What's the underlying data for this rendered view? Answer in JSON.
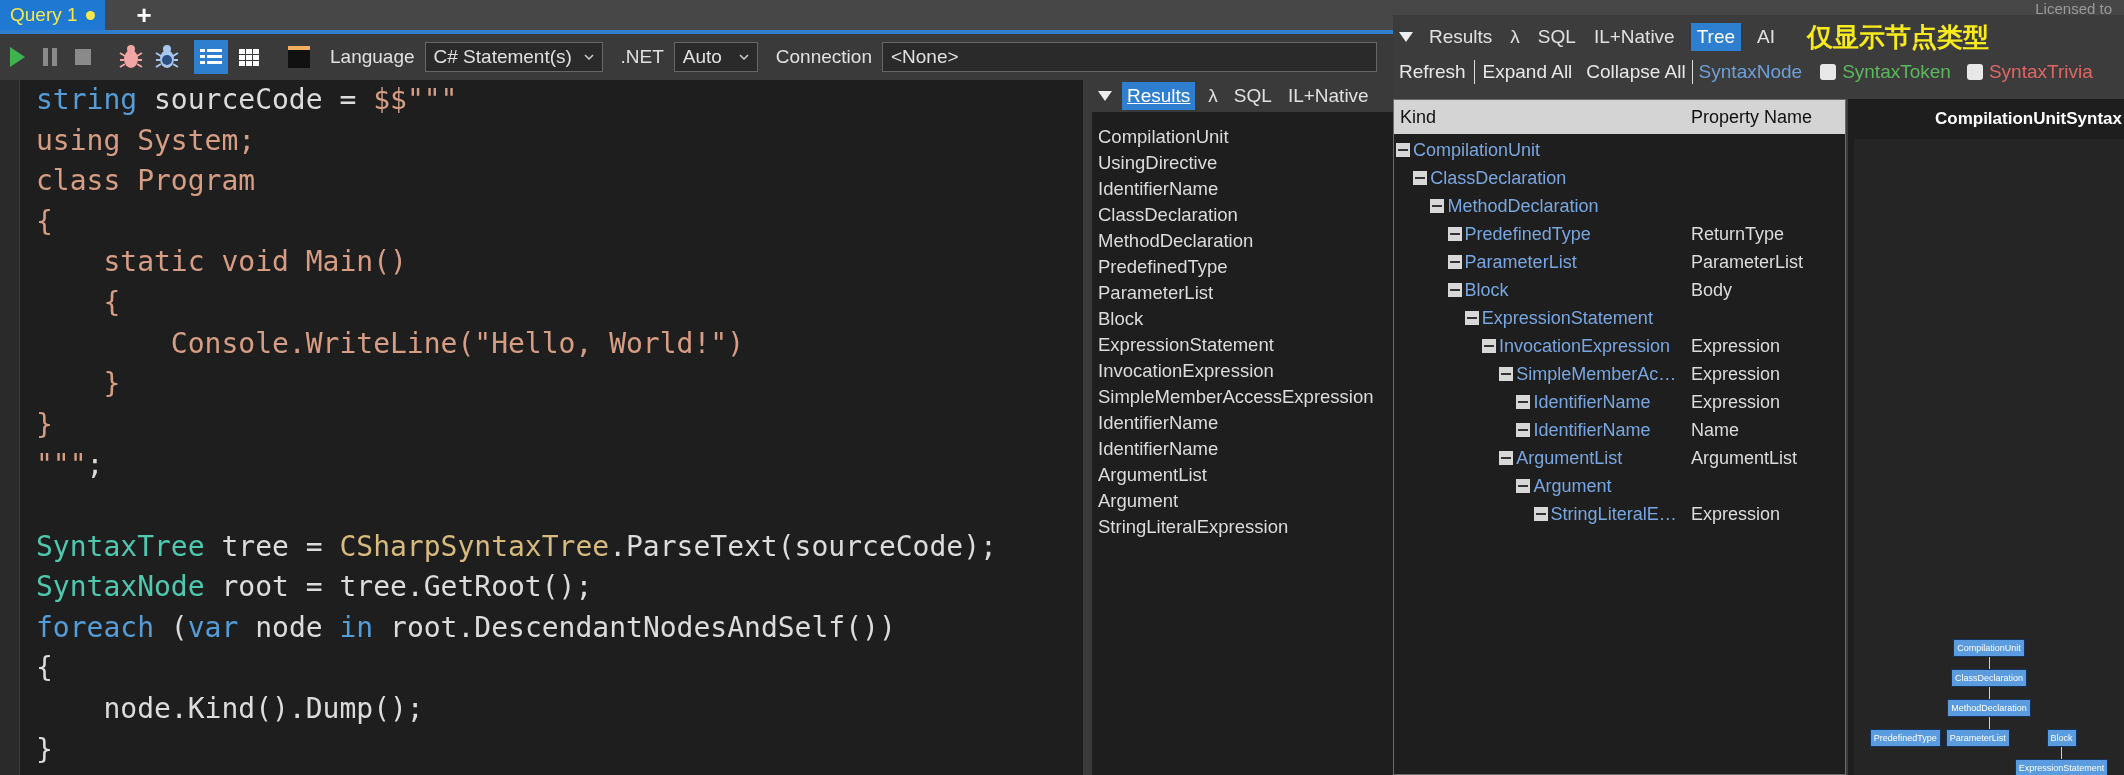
{
  "query_tabs": [
    {
      "label": "Query 1",
      "selected": true,
      "unsaved": true
    }
  ],
  "new_tab": "+",
  "licensed_text": "Licensed to",
  "toolbar": {
    "view_modes": [
      {
        "kind": "rich",
        "selected": true
      },
      {
        "kind": "grid",
        "selected": false
      }
    ],
    "language": {
      "label": "Language",
      "value": "C# Statement(s)"
    },
    "dotnet": {
      "label": ".NET",
      "value": "Auto"
    },
    "connection": {
      "label": "Connection",
      "value": "<None>"
    }
  },
  "editor": {
    "lines": [
      [
        {
          "text": "string",
          "kind": "keyword"
        },
        {
          "text": " sourceCode = ",
          "kind": "plain"
        },
        {
          "text": "$$\"\"\"",
          "kind": "string"
        }
      ],
      [
        {
          "text": "using System;",
          "kind": "string"
        }
      ],
      [
        {
          "text": "class Program",
          "kind": "string"
        }
      ],
      [
        {
          "text": "{",
          "kind": "string"
        }
      ],
      [
        {
          "text": "    static void Main()",
          "kind": "string"
        }
      ],
      [
        {
          "text": "    {",
          "kind": "string"
        }
      ],
      [
        {
          "text": "        Console.WriteLine(\"Hello, World!\")",
          "kind": "string"
        }
      ],
      [
        {
          "text": "    }",
          "kind": "string"
        }
      ],
      [
        {
          "text": "}",
          "kind": "string"
        }
      ],
      [
        {
          "text": "\"\"\"",
          "kind": "string"
        },
        {
          "text": ";",
          "kind": "plain"
        }
      ],
      [
        {
          "text": "SyntaxTree",
          "kind": "type",
          "blank_line_before": true
        },
        {
          "text": " tree = ",
          "kind": "plain"
        },
        {
          "text": "CSharpSyntaxTree",
          "kind": "class"
        },
        {
          "text": ".ParseText(sourceCode);",
          "kind": "plain"
        }
      ],
      [
        {
          "text": "SyntaxNode",
          "kind": "type"
        },
        {
          "text": " root = tree.GetRoot();",
          "kind": "plain"
        }
      ],
      [
        {
          "text": "foreach",
          "kind": "keyword"
        },
        {
          "text": " (",
          "kind": "plain"
        },
        {
          "text": "var",
          "kind": "keyword"
        },
        {
          "text": " node ",
          "kind": "plain"
        },
        {
          "text": "in",
          "kind": "keyword"
        },
        {
          "text": " root.DescendantNodesAndSelf())",
          "kind": "plain"
        }
      ],
      [
        {
          "text": "{",
          "kind": "plain"
        }
      ],
      [
        {
          "text": "    node.Kind().Dump();",
          "kind": "plain"
        }
      ],
      [
        {
          "text": "}",
          "kind": "plain"
        }
      ]
    ]
  },
  "results_panel": {
    "tabs": [
      {
        "label": "Results",
        "selected": true
      },
      {
        "label": "λ",
        "selected": false
      },
      {
        "label": "SQL",
        "selected": false
      },
      {
        "label": "IL+Native",
        "selected": false
      }
    ],
    "items": [
      "CompilationUnit",
      "UsingDirective",
      "IdentifierName",
      "ClassDeclaration",
      "MethodDeclaration",
      "PredefinedType",
      "ParameterList",
      "Block",
      "ExpressionStatement",
      "InvocationExpression",
      "SimpleMemberAccessExpression",
      "IdentifierName",
      "IdentifierName",
      "ArgumentList",
      "Argument",
      "StringLiteralExpression"
    ]
  },
  "tree_window": {
    "tabs": [
      {
        "label": "Results",
        "selected": false
      },
      {
        "label": "λ",
        "selected": false
      },
      {
        "label": "SQL",
        "selected": false
      },
      {
        "label": "IL+Native",
        "selected": false
      },
      {
        "label": "Tree",
        "selected": true
      },
      {
        "label": "AI",
        "selected": false
      }
    ],
    "annotation": "仅显示节点类型",
    "actions": [
      "Refresh",
      "Expand All",
      "Collapse All"
    ],
    "filters": [
      {
        "label": "SyntaxNode",
        "kind": "link",
        "color": "#6f9fd8"
      },
      {
        "label": "SyntaxToken",
        "kind": "checkbox",
        "checked": false,
        "color": "#5cb85c"
      },
      {
        "label": "SyntaxTrivia",
        "kind": "checkbox",
        "checked": false,
        "color": "#e06666"
      }
    ],
    "columns": [
      "Kind",
      "Property Name"
    ],
    "tree": [
      {
        "kind": "CompilationUnit",
        "expanded": true,
        "children": [
          {
            "kind": "ClassDeclaration",
            "expanded": true,
            "children": [
              {
                "kind": "MethodDeclaration",
                "expanded": true,
                "children": [
                  {
                    "kind": "PredefinedType",
                    "property": "ReturnType",
                    "expanded": true
                  },
                  {
                    "kind": "ParameterList",
                    "property": "ParameterList",
                    "expanded": true
                  },
                  {
                    "kind": "Block",
                    "property": "Body",
                    "expanded": true,
                    "children": [
                      {
                        "kind": "ExpressionStatement",
                        "expanded": true,
                        "children": [
                          {
                            "kind": "InvocationExpression",
                            "property": "Expression",
                            "expanded": true,
                            "children": [
                              {
                                "kind": "SimpleMemberAc…",
                                "property": "Expression",
                                "expanded": true,
                                "children": [
                                  {
                                    "kind": "IdentifierName",
                                    "property": "Expression",
                                    "expanded": true
                                  },
                                  {
                                    "kind": "IdentifierName",
                                    "property": "Name",
                                    "expanded": true
                                  }
                                ]
                              },
                              {
                                "kind": "ArgumentList",
                                "property": "ArgumentList",
                                "expanded": true,
                                "children": [
                                  {
                                    "kind": "Argument",
                                    "expanded": true,
                                    "children": [
                                      {
                                        "kind": "StringLiteralE…",
                                        "property": "Expression",
                                        "expanded": true
                                      }
                                    ]
                                  }
                                ]
                              }
                            ]
                          }
                        ]
                      }
                    ]
                  }
                ]
              }
            ]
          }
        ]
      }
    ],
    "graph": {
      "title": "CompilationUnitSyntax",
      "nodes": [
        {
          "label": "CompilationUnit",
          "children": [
            {
              "label": "ClassDeclaration",
              "children": [
                {
                  "label": "MethodDeclaration",
                  "children": [
                    {
                      "label": "PredefinedType"
                    },
                    {
                      "label": "ParameterList"
                    },
                    {
                      "label": "Block",
                      "children": [
                        {
                          "label": "ExpressionStatement"
                        }
                      ]
                    }
                  ]
                }
              ]
            }
          ]
        }
      ]
    }
  }
}
